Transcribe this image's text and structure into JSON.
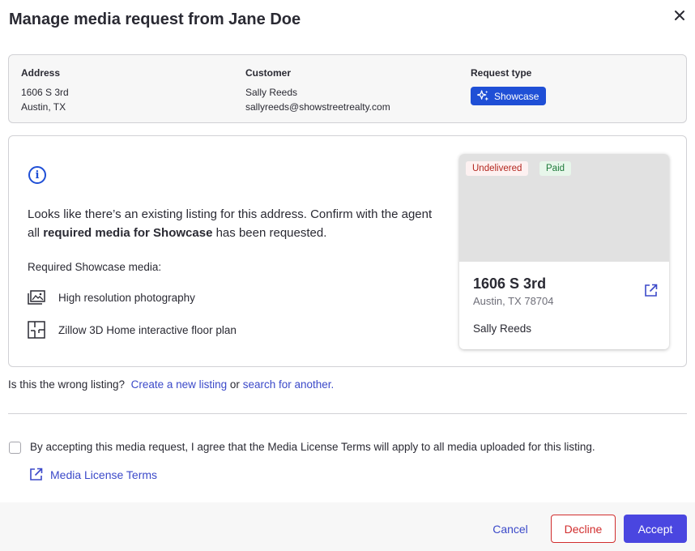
{
  "dialog": {
    "title": "Manage media request from Jane Doe"
  },
  "summary": {
    "address_label": "Address",
    "address_line1": "1606 S 3rd",
    "address_line2": "Austin, TX",
    "customer_label": "Customer",
    "customer_name": "Sally Reeds",
    "customer_email": "sallyreeds@showstreetrealty.com",
    "request_type_label": "Request type",
    "request_type_value": "Showcase"
  },
  "notice": {
    "message_prefix": "Looks like there’s an existing listing for this address. Confirm with the agent all ",
    "message_bold": "required media for Showcase",
    "message_suffix": " has been requested.",
    "required_title": "Required Showcase media:",
    "items": [
      {
        "label": "High resolution photography",
        "icon": "photos-icon"
      },
      {
        "label": "Zillow 3D Home interactive floor plan",
        "icon": "floor-plan-icon"
      }
    ]
  },
  "listing_card": {
    "status_tag": "Undelivered",
    "payment_tag": "Paid",
    "address": "1606 S 3rd",
    "city": "Austin, TX 78704",
    "agent": "Sally Reeds"
  },
  "wrong_listing": {
    "prompt": "Is this the wrong listing?",
    "create_link": "Create a new listing",
    "or_text": "or",
    "search_link": "search for another."
  },
  "agreement": {
    "text": "By accepting this media request, I agree that the Media License Terms will apply to all media uploaded for this listing.",
    "terms_link": "Media License Terms"
  },
  "footer": {
    "cancel_label": "Cancel",
    "decline_label": "Decline",
    "accept_label": "Accept"
  },
  "colors": {
    "primary_blue": "#1f4fd6",
    "link": "#3b49c9",
    "accept": "#4a46e0",
    "decline": "#d12d2d"
  }
}
